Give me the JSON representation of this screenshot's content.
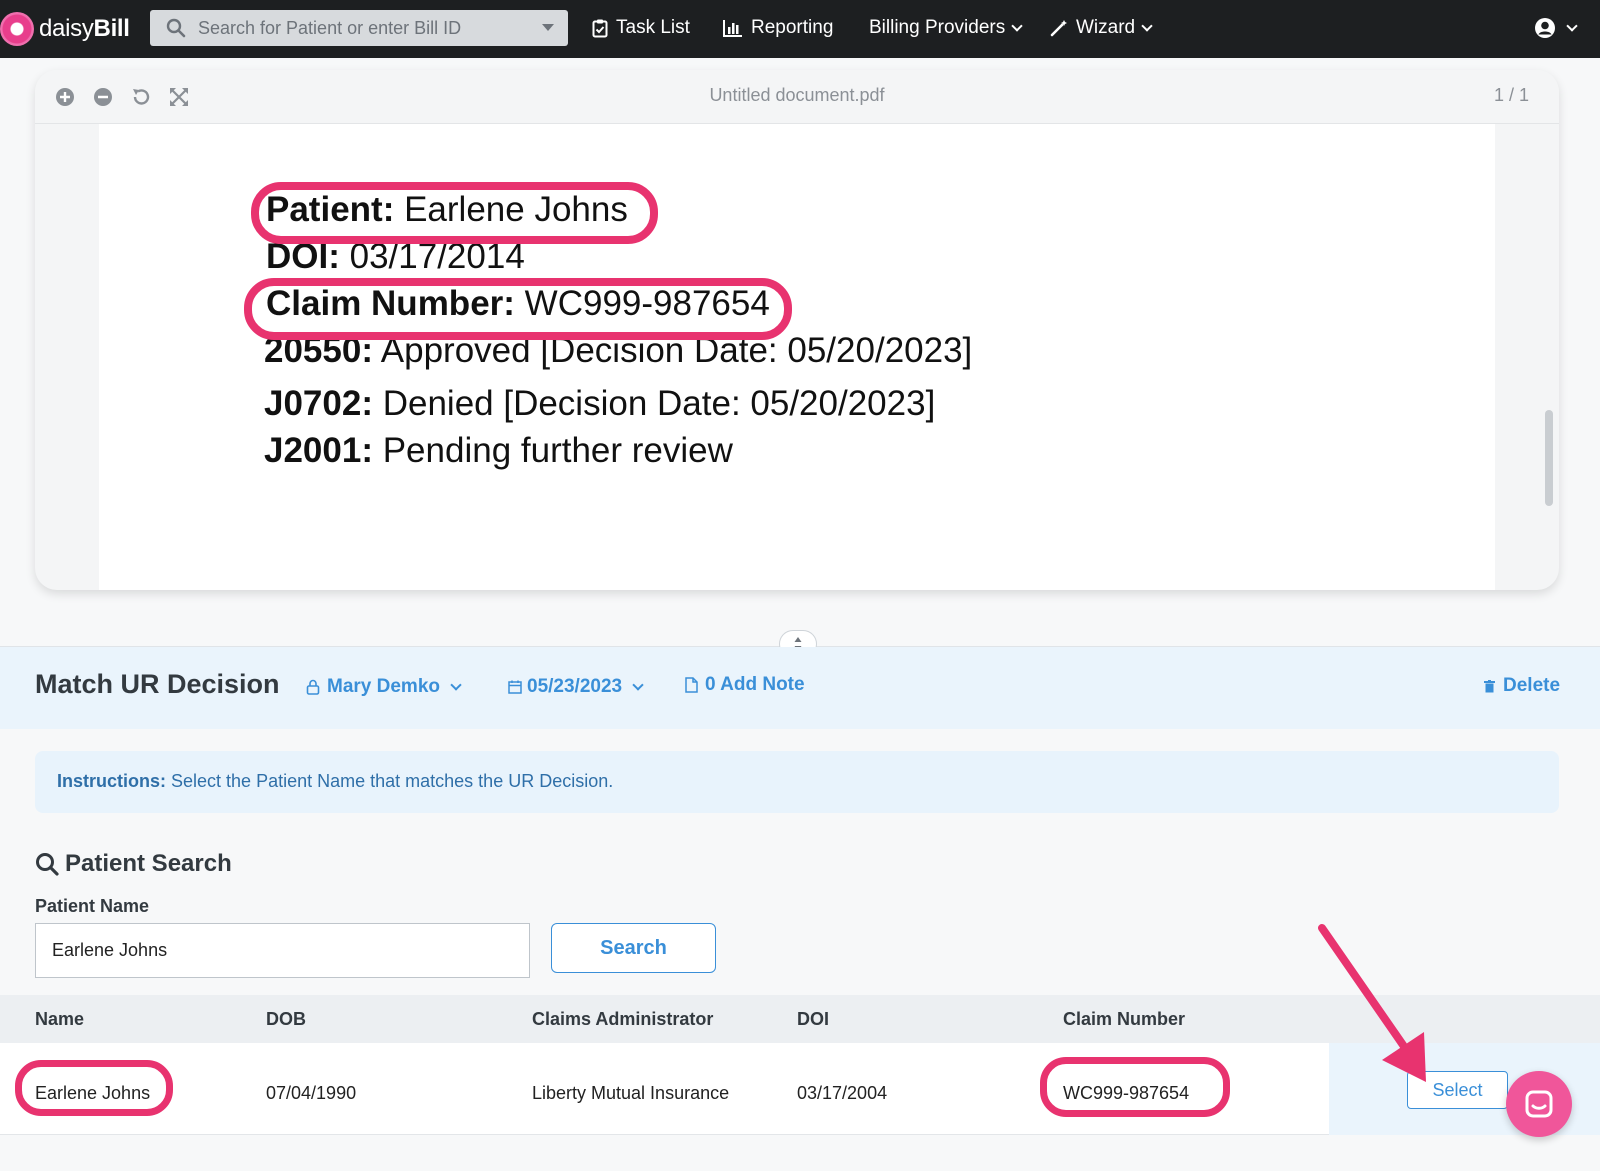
{
  "app": {
    "brand_prefix": "daisy",
    "brand_suffix": "Bill",
    "search_placeholder": "Search for Patient or enter Bill ID",
    "nav": {
      "task_list": "Task List",
      "reporting": "Reporting",
      "billing_providers": "Billing Providers",
      "wizard": "Wizard"
    }
  },
  "viewer": {
    "doc_title": "Untitled document.pdf",
    "page_count": "1 / 1",
    "lines": [
      {
        "label": "Patient:",
        "value": " Earlene Johns"
      },
      {
        "label": "DOI:",
        "value": " 03/17/2014"
      },
      {
        "label": "Claim Number:",
        "value": " WC999-987654"
      },
      {
        "label": "20550:",
        "value": " Approved [Decision Date: 05/20/2023]"
      },
      {
        "label": "J0702:",
        "value": " Denied [Decision Date: 05/20/2023]"
      },
      {
        "label": "J2001:",
        "value": " Pending further review"
      }
    ]
  },
  "panel": {
    "title": "Match UR Decision",
    "assignee": "Mary Demko",
    "date": "05/23/2023",
    "note": "0 Add Note",
    "delete": "Delete",
    "instructions_label": "Instructions:",
    "instructions_text": " Select the Patient Name that matches the UR Decision."
  },
  "search": {
    "title": "Patient Search",
    "field_label": "Patient Name",
    "field_value": "Earlene Johns",
    "button": "Search"
  },
  "table": {
    "headers": [
      "Name",
      "DOB",
      "Claims Administrator",
      "DOI",
      "Claim Number"
    ],
    "rows": [
      {
        "name": "Earlene Johns",
        "dob": "07/04/1990",
        "admin": "Liberty Mutual Insurance",
        "doi": "03/17/2004",
        "claim": "WC999-987654",
        "action": "Select"
      }
    ]
  },
  "colors": {
    "accent": "#3a8fd8",
    "highlight": "#e8336f",
    "nav_bg": "#1d1f21",
    "panel_bg": "#eaf4fc"
  }
}
